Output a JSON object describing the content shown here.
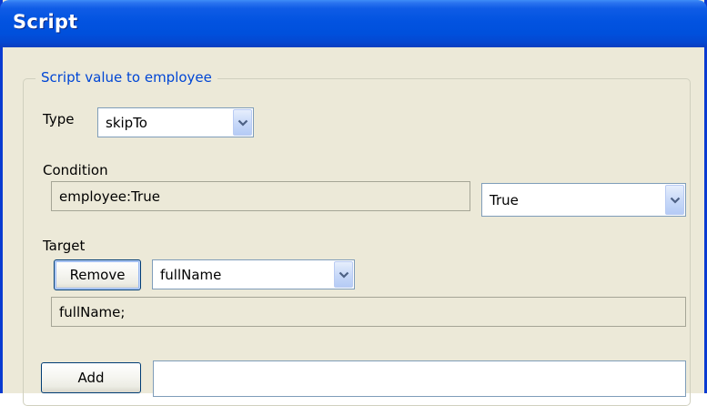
{
  "window": {
    "title": "Script"
  },
  "group": {
    "legend": "Script value to employee"
  },
  "type": {
    "label": "Type",
    "selected": "skipTo"
  },
  "condition": {
    "label": "Condition",
    "expression": "employee:True",
    "selected": "True"
  },
  "target": {
    "label": "Target",
    "remove_label": "Remove",
    "selected": "fullName",
    "list_text": "fullName;"
  },
  "add": {
    "button_label": "Add",
    "field_value": ""
  },
  "icons": {
    "dropdown": "chevron-down-icon"
  },
  "colors": {
    "titlebar": "#0253e0",
    "window_background": "#ece9d8",
    "legend_text": "#0046d5",
    "field_border": "#7f9db9"
  }
}
